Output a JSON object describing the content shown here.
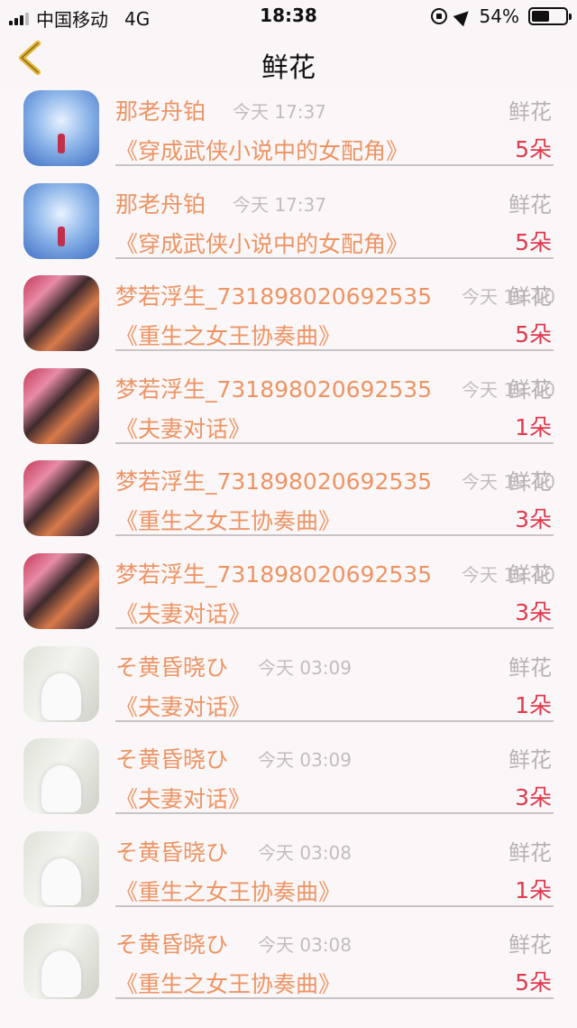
{
  "status_bar": {
    "carrier": "中国移动",
    "network": "4G",
    "time": "18:38",
    "battery": "54%",
    "battery_level": 0.54
  },
  "nav": {
    "title": "鲜花",
    "back_icon": "chevron-left-icon"
  },
  "colors": {
    "name": "#ed9464",
    "count": "#df3b4e",
    "meta": "#c2bcbd",
    "divider": "#c8c4c5"
  },
  "rows": [
    {
      "avatar": "blue",
      "name": "那老舟铂",
      "time": "今天 17:37",
      "kind": "鲜花",
      "book": "《穿成武侠小说中的女配角》",
      "count": "5朵"
    },
    {
      "avatar": "blue",
      "name": "那老舟铂",
      "time": "今天 17:37",
      "kind": "鲜花",
      "book": "《穿成武侠小说中的女配角》",
      "count": "5朵"
    },
    {
      "avatar": "umbrella",
      "name": "梦若浮生_731898020692535",
      "time": "今天 19:10",
      "kind": "鲜花",
      "book": "《重生之女王协奏曲》",
      "count": "5朵"
    },
    {
      "avatar": "umbrella",
      "name": "梦若浮生_731898020692535",
      "time": "今天 19:10",
      "kind": "鲜花",
      "book": "《夫妻对话》",
      "count": "1朵"
    },
    {
      "avatar": "umbrella",
      "name": "梦若浮生_731898020692535",
      "time": "今天 19:10",
      "kind": "鲜花",
      "book": "《重生之女王协奏曲》",
      "count": "3朵"
    },
    {
      "avatar": "umbrella",
      "name": "梦若浮生_731898020692535",
      "time": "今天 19:10",
      "kind": "鲜花",
      "book": "《夫妻对话》",
      "count": "3朵"
    },
    {
      "avatar": "girl",
      "name": "そ黄昏晓ひ",
      "time": "今天 03:09",
      "kind": "鲜花",
      "book": "《夫妻对话》",
      "count": "1朵"
    },
    {
      "avatar": "girl",
      "name": "そ黄昏晓ひ",
      "time": "今天 03:09",
      "kind": "鲜花",
      "book": "《夫妻对话》",
      "count": "3朵"
    },
    {
      "avatar": "girl",
      "name": "そ黄昏晓ひ",
      "time": "今天 03:08",
      "kind": "鲜花",
      "book": "《重生之女王协奏曲》",
      "count": "1朵"
    },
    {
      "avatar": "girl",
      "name": "そ黄昏晓ひ",
      "time": "今天 03:08",
      "kind": "鲜花",
      "book": "《重生之女王协奏曲》",
      "count": "5朵"
    }
  ]
}
